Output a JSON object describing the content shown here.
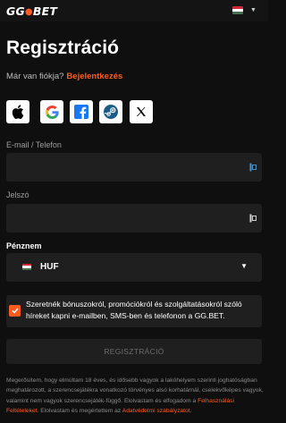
{
  "header": {
    "logo_gg": "GG",
    "logo_dot": "●",
    "logo_bet": "BET",
    "language_flag_colors": [
      "#ce2939",
      "#ffffff",
      "#477050"
    ]
  },
  "form": {
    "title": "Regisztráció",
    "have_account_text": "Már van fiókja?",
    "login_link": "Bejelentkezés",
    "social_buttons": [
      {
        "icon": "apple-icon"
      },
      {
        "icon": "google-icon"
      },
      {
        "icon": "facebook-icon"
      },
      {
        "icon": "steam-icon"
      },
      {
        "icon": "x-icon"
      }
    ],
    "email_label": "E-mail / Telefon",
    "email_value": "",
    "password_label": "Jelszó",
    "password_value": "",
    "currency_label": "Pénznem",
    "currency_value": "HUF",
    "consent_text": "Szeretnék bónuszokról, promóciókról és szolgáltatásokról szóló híreket kapni e-mailben, SMS-ben és telefonon a GG.BET.",
    "consent_checked": true,
    "submit_label": "REGISZTRÁCIÓ",
    "legal_text_1": "Megerősítem, hogy elmúltam 18 éves, és idősebb vagyok a lakóhelyem szerinti joghatóságban meghatározott, a szerencsejátékra vonatkozó törvényes alsó korhatárnál, cselekvőképes vagyok, valamint nem vagyok szerencsejáték-függő. Elolvastam és elfogadom a",
    "legal_link_1": "Felhasználási Feltételeket",
    "legal_text_2": ". Elolvastam és megértettem az",
    "legal_link_2": "Adatvédelmi szabályzatot",
    "legal_text_3": "."
  },
  "colors": {
    "accent": "#ff5a1f",
    "background": "#0f0f0f",
    "field": "#1f1f1f"
  }
}
